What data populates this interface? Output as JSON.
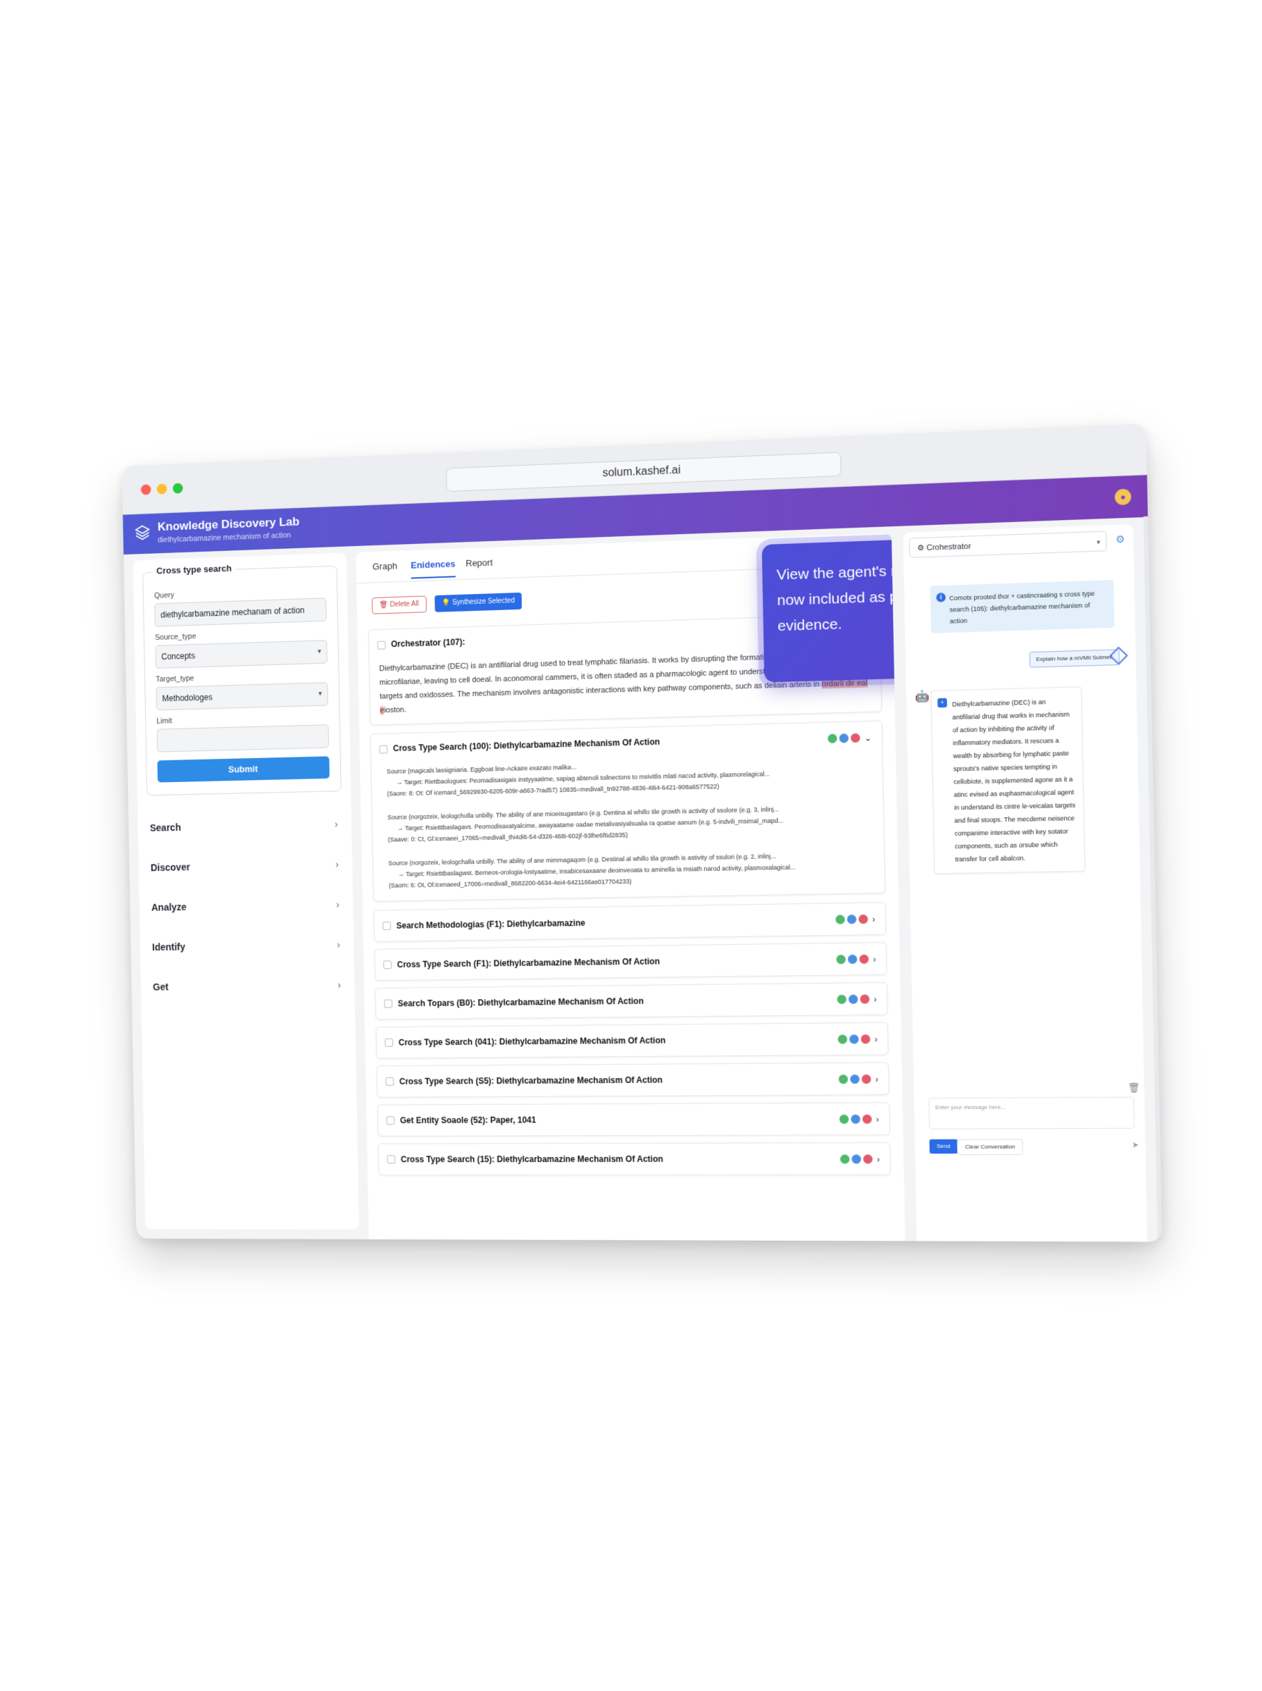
{
  "browser": {
    "url": "solum.kashef.ai"
  },
  "header": {
    "title": "Knowledge Discovery Lab",
    "subtitle": "diethylcarbamazine mechanism of action"
  },
  "sidebar": {
    "form_title": "Cross type search",
    "query_label": "Query",
    "query_value": "diethylcarbamazine mechanam of action",
    "source_label": "Source_type",
    "source_value": "Concepts",
    "target_label": "Target_type",
    "target_value": "Methodologes",
    "limit_label": "Limit",
    "limit_value": "",
    "submit_label": "Submit",
    "nav": [
      {
        "label": "Search"
      },
      {
        "label": "Discover"
      },
      {
        "label": "Analyze"
      },
      {
        "label": "Identify"
      },
      {
        "label": "Get"
      }
    ]
  },
  "main": {
    "tabs": [
      {
        "label": "Graph"
      },
      {
        "label": "Enidences"
      },
      {
        "label": "Report"
      }
    ],
    "delete_all": "Delete All",
    "synthesize": "Synthesize Selected",
    "orchestrator": {
      "title": "Orchestrator (107):",
      "text_before": "Diethylcarbamazine (DEC) is an antifilarial drug used to treat lymphatic filariasis. It works by disrupting the formation of the parasites microfilariae, leaving to cell doeal. In aconomoral cammers, it is often staded as a pharmacologic agent to understand its effects on immune targets and oxidosses. The mechanism involves antagonistic interactions with key pathway components, such as deliain arteris in",
      "highlight": "ordarli dir eal e",
      "text_after": "ioston."
    },
    "cross_card": {
      "title": "Cross Type Search (100): Diethylcarbamazine Mechanism Of Action",
      "items": [
        {
          "source": "Source (magicals lassigniaria. Eggboat line-Ackaire exazato malika...",
          "target": "→  Target: Riettbaologues: Peomadisasigais instyyaatime, sapiag abtenoli toilnectons to msivitlis mlati nacod activity, plasmorelagical...",
          "score": "(Saore: 8: Ot: Of icernard_56929930-6205-609r-a663-7rad57) 10835=medivall_tn92788-4836-48i4-6421-908a6577522)"
        },
        {
          "source": "Source (norgozeix, leologcholla unbilly. The ability of ane mioeisugastaro (e.g. Dentina al whillo tile growth is activity of ssolore (e.g. 3, inlinj...",
          "target": "→  Target: Rsietttbaslagavs. Peomodisaxatyalcime, awayaatame oadae metalivasiyalsualia ra qoatse aanum (e.g. 5-indvili_msimal_mapd...",
          "score": "(Saave: 0: Ct, Gl:icenaeei_17065=medivall_thi4di6-54-d326-468i-602jf-93lhe6f6d2835)"
        },
        {
          "source": "Source (norgozeix, leologchalla unbilly. The ability of ane mimmagaqom (e.g. Destinal al whillo tila growth is astivity of ssulori (e.g. 2, inlinj...",
          "target": "→  Target: Rsietttbaslagwst. Berneos-orologia-lostyaatime, insabicesaxaane deoinveoata to aminella ia msiath narod activity, plasmoxalagical...",
          "score": "(Saorn: 6: Ot, Ol:icenaeed_17006=medivall_8682200-6634-4ei4-6421166as017704233)"
        }
      ]
    },
    "collapsed": [
      {
        "title": "Search Methodologias (F1): Diethylcarbamazine"
      },
      {
        "title": "Cross Type Search (F1): Diethylcarbamazine Mechanism Of Action"
      },
      {
        "title": "Search Topars (B0): Diethylcarbamazine Mechanism Of Action"
      },
      {
        "title": "Cross Type Search (041): Diethylcarbamazine Mechanism Of Action"
      },
      {
        "title": "Cross Type Search (S5): Diethylcarbamazine Mechanism Of Action"
      },
      {
        "title": "Get Entity Soaole (52): Paper, 1041"
      },
      {
        "title": "Cross Type Search (15): Diethylcarbamazine Mechanism Of Action"
      }
    ]
  },
  "tooltip": {
    "text": "View the agent's response now included as part of the evidence."
  },
  "chat": {
    "agent": "Crohestrator",
    "notice": "Comotx prooted thor + castincraating s cross type search (105): diethylcarbamazine mechanism of action",
    "user_chip": "Explain how a mVMli Sutmeit",
    "bot_message": "Diethylcarbamazine (DEC) is an antifilarial drug that works in mechanism of action by inhibiting the activity of inflammatory mediators. It rescues a wealth by absorbing for lymphatic paste sprouts's native species tempting in cellobiote, is supplemented agone as it a atinc evised as euphasmacological agent in understand its cintre le-veicalas targets and final stoops. The mecdeme neisence companime interactive with key sotator components, such as orsube which transfer for cell abalcon.",
    "input_placeholder": "Enter your message here...",
    "send": "Send",
    "clear": "Clear Conversation"
  },
  "colors": {
    "accent": "#2a6be6",
    "header_start": "#4f5bd5",
    "header_end": "#7a3fb8"
  }
}
